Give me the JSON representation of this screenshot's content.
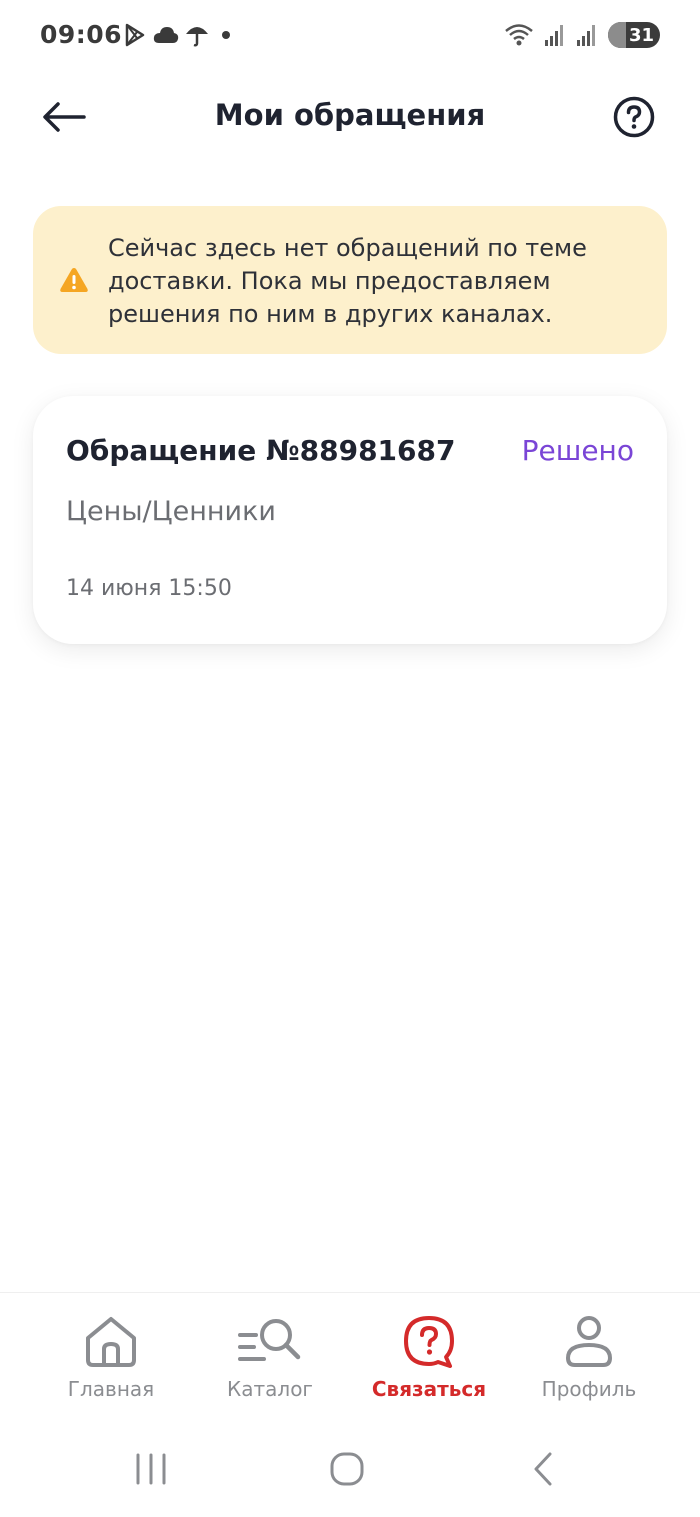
{
  "status_bar": {
    "time": "09:06",
    "battery": "31",
    "icons": [
      "play-store-icon",
      "cloud-icon",
      "umbrella-icon",
      "dot-icon",
      "wifi-icon",
      "signal-icon",
      "signal-icon"
    ]
  },
  "header": {
    "title": "Мои обращения",
    "back_icon": "arrow-left-icon",
    "help_icon": "question-circle-icon"
  },
  "notice": {
    "icon": "warning-icon",
    "text": "Сейчас здесь нет обращений по теме доставки. Пока мы предоставляем решения по ним в других каналах."
  },
  "tickets": [
    {
      "title": "Обращение №88981687",
      "status": "Решено",
      "topic": "Цены/Ценники",
      "date": "14 июня 15:50"
    }
  ],
  "bottom_nav": {
    "items": [
      {
        "label": "Главная",
        "icon": "home-icon",
        "active": false
      },
      {
        "label": "Каталог",
        "icon": "catalog-search-icon",
        "active": false
      },
      {
        "label": "Связаться",
        "icon": "chat-question-icon",
        "active": true
      },
      {
        "label": "Профиль",
        "icon": "profile-icon",
        "active": false
      }
    ]
  },
  "colors": {
    "accent_active": "#d42a2a",
    "status_resolved": "#7a45d6",
    "notice_bg": "#fdf0cc",
    "warning": "#f5a623"
  }
}
